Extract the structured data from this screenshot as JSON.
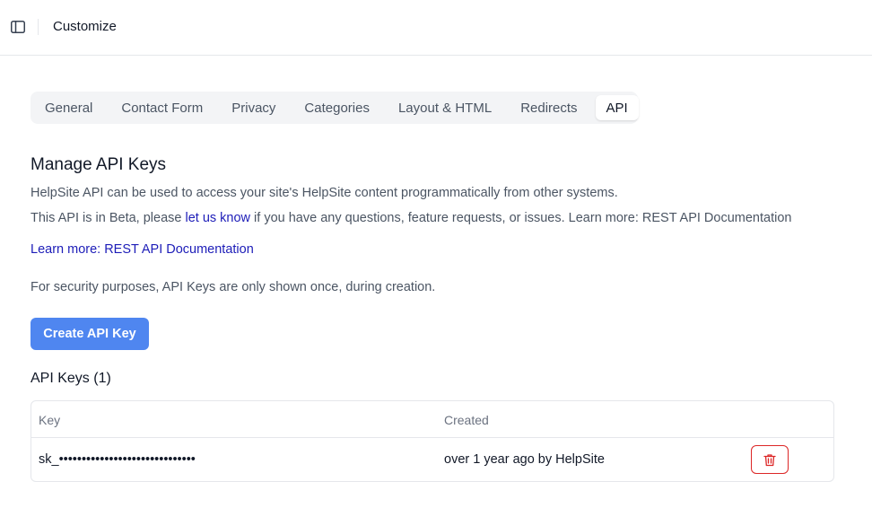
{
  "header": {
    "title": "Customize",
    "sidebar_toggle_icon": "sidebar-panel-icon"
  },
  "tabs": [
    {
      "label": "General",
      "active": false
    },
    {
      "label": "Contact Form",
      "active": false
    },
    {
      "label": "Privacy",
      "active": false
    },
    {
      "label": "Categories",
      "active": false
    },
    {
      "label": "Layout & HTML",
      "active": false
    },
    {
      "label": "Redirects",
      "active": false
    },
    {
      "label": "API",
      "active": true
    }
  ],
  "main": {
    "title": "Manage API Keys",
    "description": "HelpSite API can be used to access your site's HelpSite content programmatically from other systems.",
    "beta_prefix": "This API is in Beta, please ",
    "beta_link": "let us know",
    "beta_suffix": " if you have any questions, feature requests, or issues. Learn more: REST API Documentation",
    "docs_link": "Learn more: REST API Documentation",
    "security_note": "For security purposes, API Keys are only shown once, during creation.",
    "create_button": "Create API Key",
    "accent_color": "#4f86f0"
  },
  "keys": {
    "title": "API Keys (1)",
    "columns": [
      "Key",
      "Created"
    ],
    "rows": [
      {
        "key": "sk_••••••••••••••••••••••••••••••",
        "created": "over 1 year ago by HelpSite",
        "action_icon": "trash-icon"
      }
    ],
    "danger_color": "#dc2626"
  }
}
